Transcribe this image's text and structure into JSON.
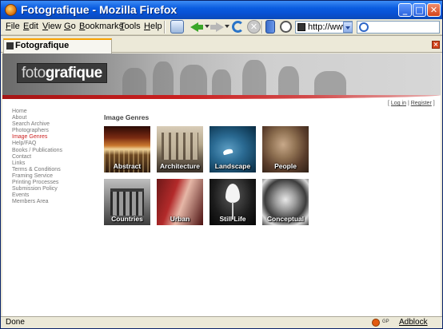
{
  "window": {
    "title": "Fotografique - Mozilla Firefox",
    "controls": [
      "minimize",
      "maximize",
      "close"
    ]
  },
  "menubar": {
    "items": [
      "File",
      "Edit",
      "View",
      "Go",
      "Bookmarks",
      "Tools",
      "Help"
    ]
  },
  "toolbar": {
    "icons": [
      "mail-icon",
      "back-icon",
      "forward-icon",
      "reload-icon",
      "stop-icon",
      "bookmark-icon",
      "history-icon"
    ],
    "url": "http://www",
    "search_placeholder": ""
  },
  "tabs": [
    {
      "label": "Fotografique",
      "active": true
    }
  ],
  "site": {
    "logo_light": "foto",
    "logo_bold": "grafique",
    "toplinks": {
      "open": "[",
      "login": "Log in",
      "sep": "|",
      "register": "Register",
      "close": "]"
    },
    "nav": [
      "Home",
      "About",
      "Search Archive",
      "Photographers",
      "Image Genres",
      "Help/FAQ",
      "Books / Publications",
      "Contact",
      "Links",
      "Terms & Conditions",
      "Framing Service",
      "Printing Processes",
      "Submission Policy",
      "Events",
      "Members Area"
    ],
    "nav_active": "Image Genres",
    "section_title": "Image Genres",
    "genres": [
      "Abstract",
      "Architecture",
      "Landscape",
      "People",
      "Countries",
      "Urban",
      "Still Life",
      "Conceptual"
    ]
  },
  "statusbar": {
    "status": "Done",
    "gp_label": "GP",
    "adblock": "Adblock"
  },
  "colors": {
    "titlebar_blue": "#0a5ce0",
    "accent_red": "#c92020",
    "nav_grey": "#777777",
    "nav_active": "#cc2222"
  }
}
